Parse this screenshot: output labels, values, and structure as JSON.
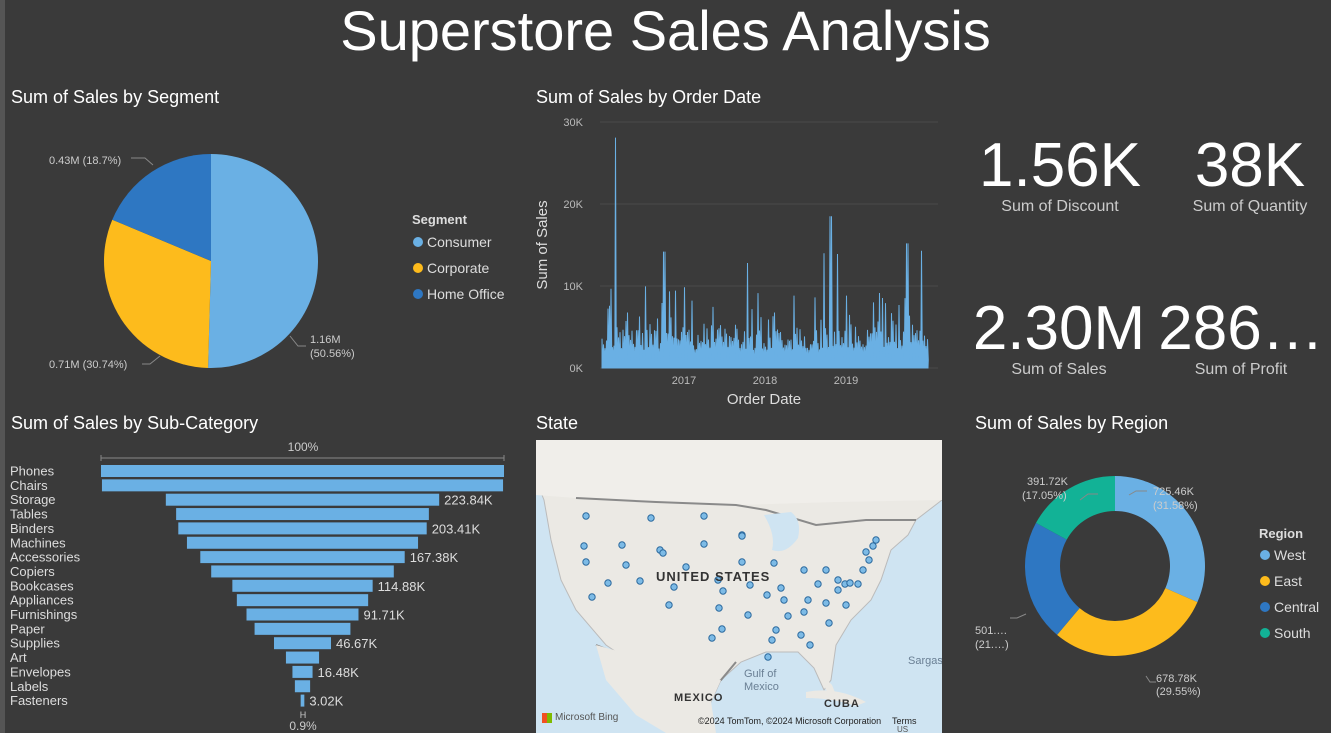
{
  "title": "Superstore Sales Analysis",
  "colors": {
    "background": "#3a3a3a",
    "light_blue": "#6ab0e4",
    "yellow": "#fdbb1c",
    "dark_blue": "#2e77c2",
    "teal": "#12b296"
  },
  "segment_pie": {
    "title": "Sum of Sales by Segment",
    "legend_title": "Segment",
    "legend": [
      "Consumer",
      "Corporate",
      "Home Office"
    ],
    "labels": {
      "consumer_line1": "1.16M",
      "consumer_line2": "(50.56%)",
      "corporate": "0.71M (30.74%)",
      "home_office": "0.43M (18.7%)"
    }
  },
  "order_date_chart": {
    "title": "Sum of Sales by Order Date",
    "ylabel": "Sum of Sales",
    "xlabel": "Order Date",
    "yticks": [
      "0K",
      "10K",
      "20K",
      "30K"
    ],
    "xticks": [
      "2017",
      "2018",
      "2019"
    ]
  },
  "kpis": {
    "discount_value": "1.56K",
    "discount_label": "Sum of Discount",
    "quantity_value": "38K",
    "quantity_label": "Sum of Quantity",
    "sales_value": "2.30M",
    "sales_label": "Sum of Sales",
    "profit_value": "286…",
    "profit_label": "Sum of Profit"
  },
  "subcategory_funnel": {
    "title": "Sum of Sales by Sub-Category",
    "top_pct": "100%",
    "bottom_pct": "0.9%",
    "bottom_tick": "H"
  },
  "map": {
    "title": "State",
    "country": "UNITED STATES",
    "mexico": "MEXICO",
    "gulf1": "Gulf of",
    "gulf2": "Mexico",
    "cuba": "CUBA",
    "sargasso": "Sargas",
    "bing": "Microsoft Bing",
    "copyright": "©2024 TomTom, ©2024 Microsoft Corporation",
    "terms": "Terms",
    "us": "US"
  },
  "region_donut": {
    "title": "Sum of Sales by Region",
    "legend_title": "Region",
    "legend": [
      "West",
      "East",
      "Central",
      "South"
    ],
    "labels": {
      "west_line1": "725.46K",
      "west_line2": "(31.58%)",
      "east_line1": "678.78K",
      "east_line2": "(29.55%)",
      "central_line1": "501.…",
      "central_line2": "(21.…)",
      "south_line1": "391.72K",
      "south_line2": "(17.05%)"
    }
  },
  "chart_data": [
    {
      "type": "pie",
      "title": "Sum of Sales by Segment",
      "categories": [
        "Consumer",
        "Corporate",
        "Home Office"
      ],
      "values": [
        1.16,
        0.71,
        0.43
      ],
      "percent": [
        50.56,
        30.74,
        18.7
      ],
      "unit": "M"
    },
    {
      "type": "bar",
      "title": "Sum of Sales by Sub-Category",
      "categories": [
        "Phones",
        "Chairs",
        "Storage",
        "Tables",
        "Binders",
        "Machines",
        "Accessories",
        "Copiers",
        "Bookcases",
        "Appliances",
        "Furnishings",
        "Paper",
        "Supplies",
        "Art",
        "Envelopes",
        "Labels",
        "Fasteners"
      ],
      "values": [
        330007,
        328449,
        223843,
        206965,
        203412,
        189238,
        167380,
        149528,
        114880,
        107532,
        91705,
        78479,
        46674,
        27119,
        16476,
        12486,
        3024
      ],
      "value_labels": [
        "",
        "",
        "223.84K",
        "",
        "203.41K",
        "",
        "167.38K",
        "",
        "114.88K",
        "",
        "91.71K",
        "",
        "46.67K",
        "",
        "16.48K",
        "",
        "3.02K"
      ]
    },
    {
      "type": "line",
      "title": "Sum of Sales by Order Date",
      "xlabel": "Order Date",
      "ylabel": "Sum of Sales",
      "ylim": [
        0,
        30000
      ],
      "x_range": [
        "2016-01",
        "2019-12"
      ],
      "peaks": [
        {
          "x": "2016-03",
          "y": 28100
        },
        {
          "x": "2016-10",
          "y": 14200
        },
        {
          "x": "2017-10",
          "y": 12800
        },
        {
          "x": "2018-09",
          "y": 14000
        },
        {
          "x": "2018-10",
          "y": 18500
        },
        {
          "x": "2018-11",
          "y": 13900
        },
        {
          "x": "2019-09",
          "y": 15200
        },
        {
          "x": "2019-11",
          "y": 14300
        }
      ]
    },
    {
      "type": "pie",
      "title": "Sum of Sales by Region",
      "categories": [
        "West",
        "East",
        "Central",
        "South"
      ],
      "values": [
        725.46,
        678.78,
        501.24,
        391.72
      ],
      "percent": [
        31.58,
        29.55,
        21.82,
        17.05
      ],
      "unit": "K"
    }
  ]
}
